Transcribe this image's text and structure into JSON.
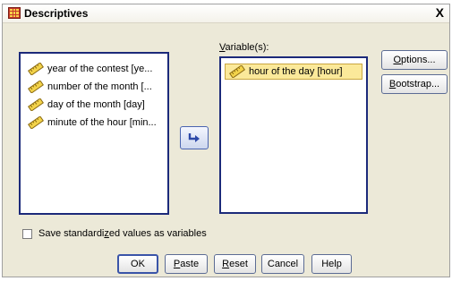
{
  "window": {
    "title": "Descriptives",
    "close_label": "X"
  },
  "source_list": {
    "items": [
      {
        "label": "year of the contest [ye..."
      },
      {
        "label": "number of the month [..."
      },
      {
        "label": "day of the month [day]"
      },
      {
        "label": "minute of the hour [min..."
      }
    ]
  },
  "target": {
    "label_underlined": "V",
    "label_rest": "ariable(s):",
    "items": [
      {
        "label": "hour of the day [hour]",
        "selected": true
      }
    ]
  },
  "side_buttons": {
    "options_underlined": "O",
    "options_rest": "ptions...",
    "bootstrap_underlined": "B",
    "bootstrap_rest": "ootstrap..."
  },
  "checkbox": {
    "label_before": "Save standardi",
    "label_underlined": "z",
    "label_after": "ed values as variables",
    "checked": false
  },
  "buttons": {
    "ok": "OK",
    "paste_underlined": "P",
    "paste_rest": "aste",
    "reset_underlined": "R",
    "reset_rest": "eset",
    "cancel": "Cancel",
    "help": "Help"
  },
  "colors": {
    "accent": "#1c2a7a",
    "selected_bg": "#fbe99a",
    "dialog_bg": "#ece9d8"
  }
}
